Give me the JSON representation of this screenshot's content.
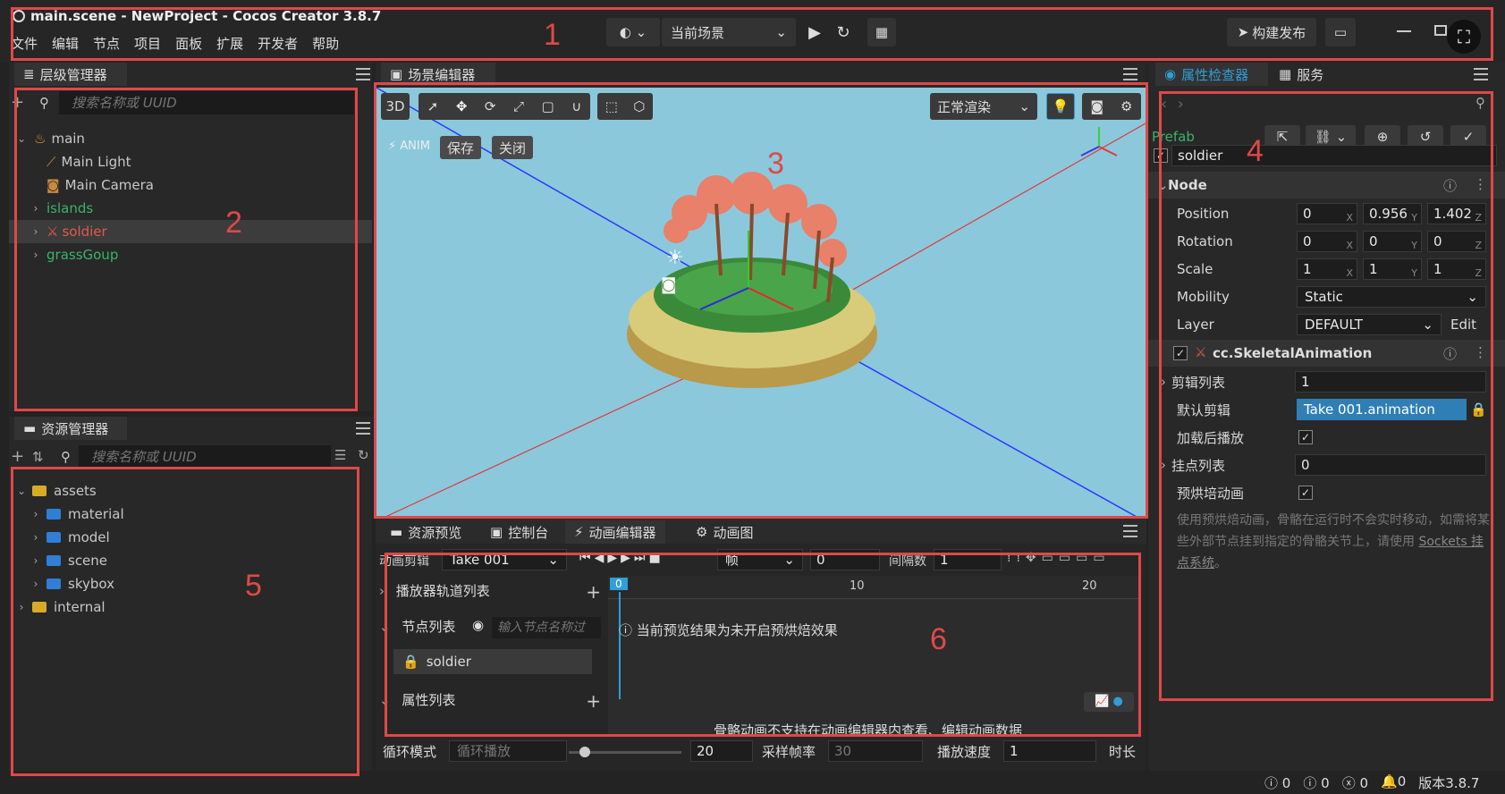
{
  "window": {
    "title": "main.scene - NewProject - Cocos Creator 3.8.7"
  },
  "menu": [
    "文件",
    "编辑",
    "节点",
    "项目",
    "面板",
    "扩展",
    "开发者",
    "帮助"
  ],
  "toolbar": {
    "scene_select": "当前场景",
    "build_label": "构建发布"
  },
  "hierarchy": {
    "title": "层级管理器",
    "search_placeholder": "搜索名称或 UUID",
    "nodes": [
      {
        "label": "main"
      },
      {
        "label": "Main Light"
      },
      {
        "label": "Main Camera"
      },
      {
        "label": "islands"
      },
      {
        "label": "soldier"
      },
      {
        "label": "grassGoup"
      }
    ]
  },
  "assets": {
    "title": "资源管理器",
    "search_placeholder": "搜索名称或 UUID",
    "items": [
      {
        "label": "assets"
      },
      {
        "label": "material"
      },
      {
        "label": "model"
      },
      {
        "label": "scene"
      },
      {
        "label": "skybox"
      },
      {
        "label": "internal"
      }
    ]
  },
  "scene_editor": {
    "title": "场景编辑器",
    "mode_3d": "3D",
    "render_mode": "正常渲染",
    "anim_label": "ANIM",
    "save_label": "保存",
    "close_label": "关闭"
  },
  "bottom_tabs": [
    "资源预览",
    "控制台",
    "动画编辑器",
    "动画图"
  ],
  "animation": {
    "clip_label": "动画剪辑",
    "clip_value": "Take 001",
    "frame_unit": "帧",
    "frame_value": "0",
    "interval_label": "间隔数",
    "interval_value": "1",
    "track_list": "播放器轨道列表",
    "node_list": "节点列表",
    "node_filter_placeholder": "输入节点名称过",
    "node_item": "soldier",
    "prop_list": "属性列表",
    "notice": "当前预览结果为未开启预烘焙效果",
    "skeletal_notice": "骨骼动画不支持在动画编辑器内查看、编辑动画数据",
    "ruler": [
      "0",
      "10",
      "20"
    ],
    "loop_mode_label": "循环模式",
    "loop_mode_value": "循环播放",
    "slider_value": "20",
    "sample_label": "采样帧率",
    "sample_value": "30",
    "speed_label": "播放速度",
    "speed_value": "1",
    "duration_label": "时长"
  },
  "inspector": {
    "tab_inspector": "属性检查器",
    "tab_services": "服务",
    "prefab_label": "Prefab",
    "node_name": "soldier",
    "node_section": "Node",
    "position": {
      "label": "Position",
      "x": "0",
      "y": "0.956",
      "z": "1.402"
    },
    "rotation": {
      "label": "Rotation",
      "x": "0",
      "y": "0",
      "z": "0"
    },
    "scale": {
      "label": "Scale",
      "x": "1",
      "y": "1",
      "z": "1"
    },
    "mobility": {
      "label": "Mobility",
      "value": "Static"
    },
    "layer": {
      "label": "Layer",
      "value": "DEFAULT",
      "edit": "Edit"
    },
    "component": "cc.SkeletalAnimation",
    "clips": {
      "label": "剪辑列表",
      "value": "1"
    },
    "default_clip": {
      "label": "默认剪辑",
      "value": "Take 001.animation"
    },
    "play_on_load": {
      "label": "加载后播放"
    },
    "sockets": {
      "label": "挂点列表",
      "value": "0"
    },
    "baked": {
      "label": "预烘培动画"
    },
    "description": "使用预烘焙动画，骨骼在运行时不会实时移动，如需将某些外部节点挂到指定的骨骼关节上，请使用",
    "link": "Sockets 挂点系统",
    "link_suffix": "。"
  },
  "status": {
    "info": "0",
    "warn": "0",
    "error": "0",
    "notice": "0",
    "version": "版本3.8.7"
  },
  "annotations": [
    "1",
    "2",
    "3",
    "4",
    "5",
    "6"
  ],
  "colors": {
    "accent": "#2f9fd6",
    "annotation": "#e04848",
    "selected_node": "#e05a4a",
    "scene_bg": "#8cc8dc"
  }
}
